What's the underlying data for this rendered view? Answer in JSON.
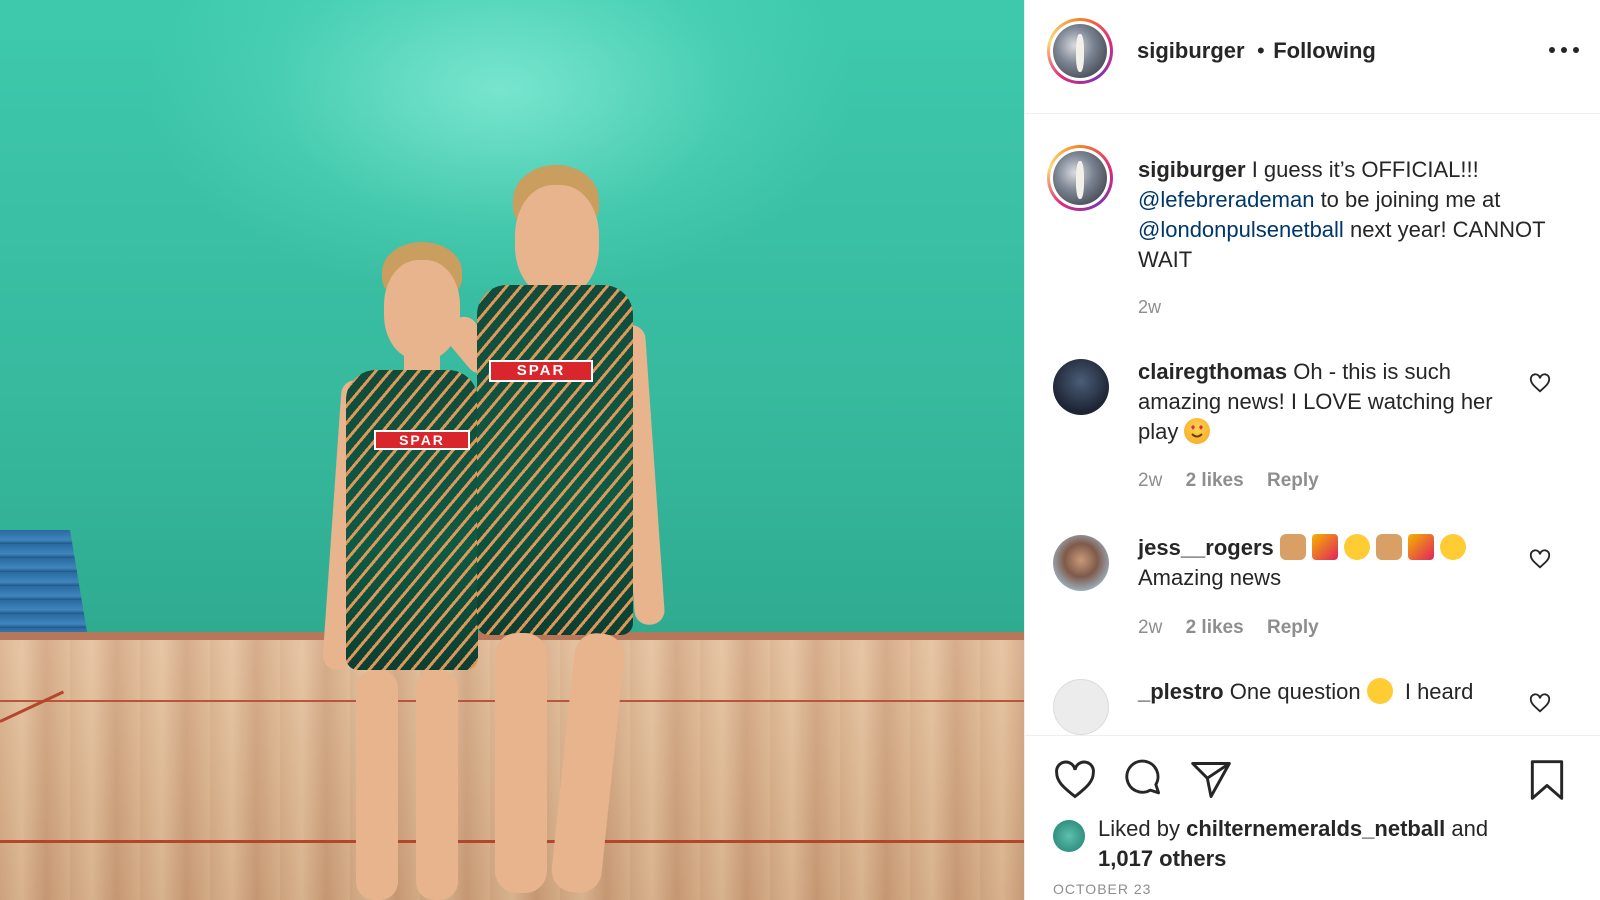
{
  "post": {
    "photo_alt": "Two netball players in green SPAR dresses standing on an indoor court",
    "photo_logo_text": "SPAR"
  },
  "header": {
    "username": "sigiburger",
    "separator": "•",
    "follow_status": "Following"
  },
  "caption": {
    "username": "sigiburger",
    "text_1": "I guess it’s OFFICIAL!!!",
    "mention_1": "@lefebrerademan",
    "text_2": "to be joining me at",
    "mention_2": "@londonpulsenetball",
    "text_3": "next year! CANNOT WAIT",
    "time": "2w"
  },
  "comments": [
    {
      "username": "clairegthomas",
      "text": "Oh - this is such amazing news! I LOVE watching her play",
      "emoji": "heart-eyes-emoji",
      "time": "2w",
      "likes": "2 likes",
      "reply": "Reply"
    },
    {
      "username": "jess__rogers",
      "text": "Amazing news",
      "emoji_sequence": [
        "raising-hands-emoji",
        "party-popper-emoji",
        "smiling-sweat-emoji",
        "raising-hands-emoji",
        "party-popper-emoji",
        "smiling-sweat-emoji"
      ],
      "time": "2w",
      "likes": "2 likes",
      "reply": "Reply"
    },
    {
      "username": "_plestro",
      "text": "One question",
      "emoji": "thinking-face-emoji",
      "text_after": "I heard"
    }
  ],
  "actions": {
    "liked_by_prefix": "Liked by",
    "liked_by_user": "chilternemeralds_netball",
    "liked_by_and": "and",
    "others": "1,017 others",
    "date": "OCTOBER 23"
  },
  "colors": {
    "mention": "#00376b",
    "meta": "#8e8e8e",
    "text": "#262626",
    "wall": "#37b99e"
  }
}
